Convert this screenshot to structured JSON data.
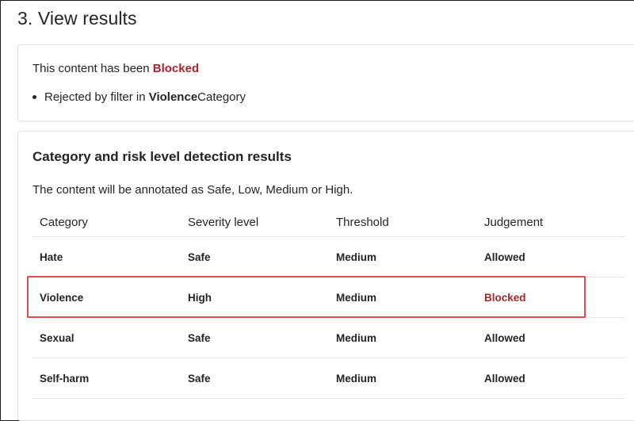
{
  "page": {
    "title": "3. View results"
  },
  "result": {
    "status_prefix": "This content has been ",
    "status_value": "Blocked",
    "reason_prefix": "Rejected by filter in ",
    "reason_category": "Violence",
    "reason_suffix": " Category"
  },
  "detection": {
    "title": "Category and risk level detection results",
    "description": "The content will be annotated as Safe, Low, Medium or High.",
    "columns": [
      "Category",
      "Severity level",
      "Threshold",
      "Judgement"
    ],
    "rows": [
      {
        "category": "Hate",
        "severity": "Safe",
        "threshold": "Medium",
        "judgement": "Allowed"
      },
      {
        "category": "Violence",
        "severity": "High",
        "threshold": "Medium",
        "judgement": "Blocked"
      },
      {
        "category": "Sexual",
        "severity": "Safe",
        "threshold": "Medium",
        "judgement": "Allowed"
      },
      {
        "category": "Self-harm",
        "severity": "Safe",
        "threshold": "Medium",
        "judgement": "Allowed"
      }
    ]
  },
  "colors": {
    "blocked": "#a4262c",
    "highlight_outline": "#e04f4f"
  }
}
